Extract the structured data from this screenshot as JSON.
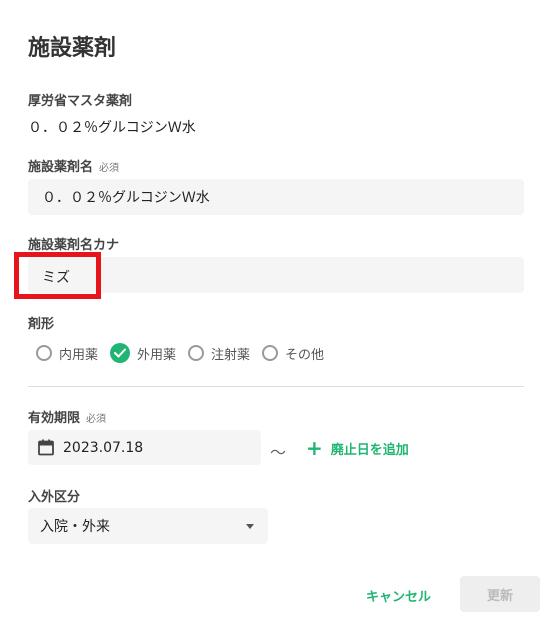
{
  "dialog": {
    "title": "施設薬剤"
  },
  "master_drug": {
    "label": "厚労省マスタ薬剤",
    "value": "０．０２％グルコジンＷ水"
  },
  "facility_drug_name": {
    "label": "施設薬剤名",
    "required": "必須",
    "value": "０．０２％グルコジンＷ水"
  },
  "facility_drug_kana": {
    "label": "施設薬剤名カナ",
    "value": "ミズ"
  },
  "dosage_form": {
    "label": "剤形",
    "options": [
      {
        "label": "内用薬",
        "selected": false
      },
      {
        "label": "外用薬",
        "selected": true
      },
      {
        "label": "注射薬",
        "selected": false
      },
      {
        "label": "その他",
        "selected": false
      }
    ]
  },
  "validity_period": {
    "label": "有効期限",
    "required": "必須",
    "start_date": "2023.07.18",
    "separator": "〜",
    "add_end_date_label": "廃止日を追加"
  },
  "inpatient_outpatient": {
    "label": "入外区分",
    "selected": "入院・外来"
  },
  "footer": {
    "cancel_label": "キャンセル",
    "update_label": "更新"
  },
  "colors": {
    "accent": "#21b573",
    "highlight": "#e8141c"
  }
}
